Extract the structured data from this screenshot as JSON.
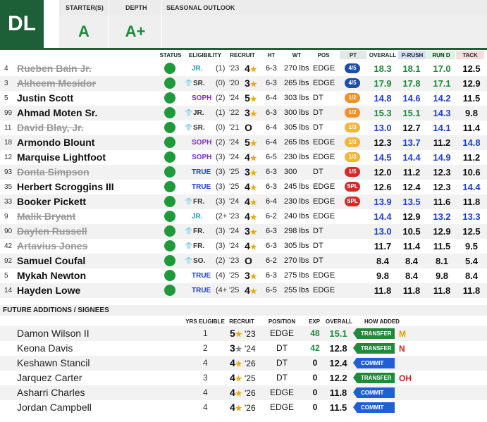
{
  "header": {
    "position": "DL",
    "starters_label": "STARTER(S)",
    "depth_label": "DEPTH",
    "outlook_label": "SEASONAL OUTLOOK",
    "starters_grade": "A",
    "depth_grade": "A+"
  },
  "columns": {
    "status": "STATUS",
    "eligibility": "ELIGIBILITY",
    "recruit": "RECRUIT",
    "ht": "HT",
    "wt": "WT",
    "pos": "POS",
    "pt": "PT",
    "overall": "OVERALL",
    "prush": "P-RUSH",
    "rund": "RUN D",
    "tack": "TACK"
  },
  "players": [
    {
      "num": "4",
      "name": "Rueben Bain Jr.",
      "out": true,
      "cls": "JR.",
      "cls_color": "#1a9bbd",
      "redshirt": false,
      "yr": "(1)",
      "rec": "'23",
      "star": "4",
      "ht": "6-3",
      "wt": "270 lbs",
      "pos": "EDGE",
      "pt": "4/5",
      "pt_color": "#1f4ea8",
      "ov": "18.3",
      "ov_c": "#1e8a3a",
      "pr": "18.1",
      "pr_c": "#1e8a3a",
      "rd": "17.0",
      "rd_c": "#1e8a3a",
      "tk": "12.5",
      "tk_c": "#111"
    },
    {
      "num": "3",
      "name": "Akheem Mesidor",
      "out": true,
      "cls": "SR.",
      "cls_color": "#333",
      "redshirt": true,
      "yr": "(0)",
      "rec": "'20",
      "star": "3",
      "ht": "6-3",
      "wt": "265 lbs",
      "pos": "EDGE",
      "pt": "4/5",
      "pt_color": "#1f4ea8",
      "ov": "17.9",
      "ov_c": "#1e8a3a",
      "pr": "17.8",
      "pr_c": "#1e8a3a",
      "rd": "17.1",
      "rd_c": "#1e8a3a",
      "tk": "12.9",
      "tk_c": "#111"
    },
    {
      "num": "5",
      "name": "Justin Scott",
      "out": false,
      "cls": "SOPH",
      "cls_color": "#7a2fbf",
      "redshirt": false,
      "yr": "(2)",
      "rec": "'24",
      "star": "5",
      "ht": "6-4",
      "wt": "303 lbs",
      "pos": "DT",
      "pt": "1/2",
      "pt_color": "#f0902a",
      "ov": "14.8",
      "ov_c": "#1f3fd6",
      "pr": "14.6",
      "pr_c": "#1f3fd6",
      "rd": "14.2",
      "rd_c": "#1f3fd6",
      "tk": "11.5",
      "tk_c": "#111"
    },
    {
      "num": "99",
      "name": "Ahmad Moten Sr.",
      "out": false,
      "cls": "JR.",
      "cls_color": "#333",
      "redshirt": true,
      "yr": "(1)",
      "rec": "'22",
      "star": "3",
      "ht": "6-3",
      "wt": "300 lbs",
      "pos": "DT",
      "pt": "1/2",
      "pt_color": "#f0902a",
      "ov": "15.3",
      "ov_c": "#1e8a3a",
      "pr": "15.1",
      "pr_c": "#1e8a3a",
      "rd": "14.3",
      "rd_c": "#1f3fd6",
      "tk": "9.8",
      "tk_c": "#111"
    },
    {
      "num": "11",
      "name": "David Blay, Jr.",
      "out": true,
      "cls": "SR.",
      "cls_color": "#333",
      "redshirt": true,
      "yr": "(0)",
      "rec": "'21",
      "star": "O",
      "ht": "6-4",
      "wt": "305 lbs",
      "pos": "DT",
      "pt": "1/3",
      "pt_color": "#f2b63a",
      "ov": "13.0",
      "ov_c": "#1f3fd6",
      "pr": "12.7",
      "pr_c": "#111",
      "rd": "14.1",
      "rd_c": "#1f3fd6",
      "tk": "11.4",
      "tk_c": "#111"
    },
    {
      "num": "18",
      "name": "Armondo Blount",
      "out": false,
      "cls": "SOPH",
      "cls_color": "#7a2fbf",
      "redshirt": false,
      "yr": "(2)",
      "rec": "'24",
      "star": "5",
      "ht": "6-4",
      "wt": "265 lbs",
      "pos": "EDGE",
      "pt": "1/3",
      "pt_color": "#f2b63a",
      "ov": "12.3",
      "ov_c": "#111",
      "pr": "13.7",
      "pr_c": "#1f3fd6",
      "rd": "11.2",
      "rd_c": "#111",
      "tk": "14.8",
      "tk_c": "#1f3fd6"
    },
    {
      "num": "12",
      "name": "Marquise Lightfoot",
      "out": false,
      "cls": "SOPH",
      "cls_color": "#7a2fbf",
      "redshirt": false,
      "yr": "(3)",
      "rec": "'24",
      "star": "4",
      "ht": "6-5",
      "wt": "230 lbs",
      "pos": "EDGE",
      "pt": "1/3",
      "pt_color": "#f2b63a",
      "ov": "14.5",
      "ov_c": "#1f3fd6",
      "pr": "14.4",
      "pr_c": "#1f3fd6",
      "rd": "14.9",
      "rd_c": "#1f3fd6",
      "tk": "11.2",
      "tk_c": "#111"
    },
    {
      "num": "93",
      "name": "Donta Simpson",
      "out": true,
      "cls": "TRUE",
      "cls_color": "#1f3fd6",
      "redshirt": false,
      "yr": "(3)",
      "rec": "'25",
      "star": "3",
      "ht": "6-3",
      "wt": "300",
      "pos": "DT",
      "pt": "1/5",
      "pt_color": "#d62a2a",
      "ov": "12.0",
      "ov_c": "#111",
      "pr": "11.2",
      "pr_c": "#111",
      "rd": "12.3",
      "rd_c": "#111",
      "tk": "10.6",
      "tk_c": "#111"
    },
    {
      "num": "35",
      "name": "Herbert Scroggins III",
      "out": false,
      "cls": "TRUE",
      "cls_color": "#1f3fd6",
      "redshirt": false,
      "yr": "(3)",
      "rec": "'25",
      "star": "4",
      "ht": "6-3",
      "wt": "245 lbs",
      "pos": "EDGE",
      "pt": "SPL",
      "pt_color": "#d62a2a",
      "ov": "12.6",
      "ov_c": "#111",
      "pr": "12.4",
      "pr_c": "#111",
      "rd": "12.3",
      "rd_c": "#111",
      "tk": "14.4",
      "tk_c": "#1f3fd6"
    },
    {
      "num": "33",
      "name": "Booker Pickett",
      "out": false,
      "cls": "FR.",
      "cls_color": "#333",
      "redshirt": true,
      "yr": "(3)",
      "rec": "'24",
      "star": "4",
      "ht": "6-4",
      "wt": "230 lbs",
      "pos": "EDGE",
      "pt": "SPL",
      "pt_color": "#d62a2a",
      "ov": "13.9",
      "ov_c": "#1f3fd6",
      "pr": "13.5",
      "pr_c": "#1f3fd6",
      "rd": "11.6",
      "rd_c": "#111",
      "tk": "11.8",
      "tk_c": "#111"
    },
    {
      "num": "9",
      "name": "Malik Bryant",
      "out": true,
      "cls": "JR.",
      "cls_color": "#1a9bbd",
      "redshirt": false,
      "yr": "(2+",
      "rec": "'23",
      "star": "4",
      "ht": "6-2",
      "wt": "240 lbs",
      "pos": "EDGE",
      "pt": "",
      "pt_color": "",
      "ov": "14.4",
      "ov_c": "#1f3fd6",
      "pr": "12.9",
      "pr_c": "#111",
      "rd": "13.2",
      "rd_c": "#1f3fd6",
      "tk": "13.3",
      "tk_c": "#1f3fd6"
    },
    {
      "num": "90",
      "name": "Daylen Russell",
      "out": true,
      "cls": "FR.",
      "cls_color": "#333",
      "redshirt": true,
      "yr": "(3)",
      "rec": "'24",
      "star": "3",
      "ht": "6-3",
      "wt": "298 lbs",
      "pos": "DT",
      "pt": "",
      "pt_color": "",
      "ov": "13.0",
      "ov_c": "#1f3fd6",
      "pr": "10.5",
      "pr_c": "#111",
      "rd": "12.9",
      "rd_c": "#111",
      "tk": "12.5",
      "tk_c": "#111"
    },
    {
      "num": "42",
      "name": "Artavius Jones",
      "out": true,
      "cls": "FR.",
      "cls_color": "#333",
      "redshirt": true,
      "yr": "(3)",
      "rec": "'24",
      "star": "4",
      "ht": "6-3",
      "wt": "305 lbs",
      "pos": "DT",
      "pt": "",
      "pt_color": "",
      "ov": "11.7",
      "ov_c": "#111",
      "pr": "11.4",
      "pr_c": "#111",
      "rd": "11.5",
      "rd_c": "#111",
      "tk": "9.5",
      "tk_c": "#111"
    },
    {
      "num": "92",
      "name": "Samuel Coufal",
      "out": false,
      "cls": "SO.",
      "cls_color": "#333",
      "redshirt": true,
      "yr": "(2)",
      "rec": "'23",
      "star": "O",
      "ht": "6-2",
      "wt": "270 lbs",
      "pos": "DT",
      "pt": "",
      "pt_color": "",
      "ov": "8.4",
      "ov_c": "#111",
      "pr": "8.4",
      "pr_c": "#111",
      "rd": "8.1",
      "rd_c": "#111",
      "tk": "5.4",
      "tk_c": "#111"
    },
    {
      "num": "5",
      "name": "Mykah Newton",
      "out": false,
      "cls": "TRUE",
      "cls_color": "#1f3fd6",
      "redshirt": false,
      "yr": "(4)",
      "rec": "'25",
      "star": "3",
      "ht": "6-3",
      "wt": "275 lbs",
      "pos": "EDGE",
      "pt": "",
      "pt_color": "",
      "ov": "9.8",
      "ov_c": "#111",
      "pr": "8.4",
      "pr_c": "#111",
      "rd": "9.8",
      "rd_c": "#111",
      "tk": "8.4",
      "tk_c": "#111"
    },
    {
      "num": "14",
      "name": "Hayden Lowe",
      "out": false,
      "cls": "TRUE",
      "cls_color": "#1f3fd6",
      "redshirt": false,
      "yr": "(4+",
      "rec": "'25",
      "star": "4",
      "ht": "6-5",
      "wt": "255 lbs",
      "pos": "EDGE",
      "pt": "",
      "pt_color": "",
      "ov": "11.8",
      "ov_c": "#111",
      "pr": "11.8",
      "pr_c": "#111",
      "rd": "11.8",
      "rd_c": "#111",
      "tk": "11.8",
      "tk_c": "#111"
    }
  ],
  "future": {
    "title": "FUTURE ADDITIONS / SIGNEES",
    "columns": {
      "yrs": "YRS ELIGIBLE",
      "recruit": "RECRUIT",
      "position": "POSITION",
      "exp": "EXP",
      "overall": "OVERALL",
      "how": "HOW ADDED"
    },
    "items": [
      {
        "name": "Damon Wilson II",
        "yrs": "1",
        "star": "5",
        "star_color": "#f0a800",
        "rec": "'23",
        "pos": "EDGE",
        "exp": "48",
        "exp_c": "#1e8a3a",
        "ov": "15.1",
        "ov_c": "#1e8a3a",
        "how": "TRANSFER",
        "how_type": "transfer",
        "logo": "M",
        "logo_color": "#d9a400"
      },
      {
        "name": "Keona Davis",
        "yrs": "2",
        "star": "3",
        "star_color": "#888",
        "rec": "'24",
        "pos": "DT",
        "exp": "42",
        "exp_c": "#1e8a3a",
        "ov": "12.8",
        "ov_c": "#111",
        "how": "TRANSFER",
        "how_type": "transfer",
        "logo": "N",
        "logo_color": "#d21f1f"
      },
      {
        "name": "Keshawn Stancil",
        "yrs": "4",
        "star": "4",
        "star_color": "#f0a800",
        "rec": "'26",
        "pos": "DT",
        "exp": "0",
        "exp_c": "#111",
        "ov": "12.4",
        "ov_c": "#111",
        "how": "COMMIT",
        "how_type": "commit",
        "logo": "",
        "logo_color": ""
      },
      {
        "name": "Jarquez Carter",
        "yrs": "3",
        "star": "4",
        "star_color": "#f0a800",
        "rec": "'25",
        "pos": "DT",
        "exp": "0",
        "exp_c": "#111",
        "ov": "12.2",
        "ov_c": "#111",
        "how": "TRANSFER",
        "how_type": "transfer",
        "logo": "OH",
        "logo_color": "#c41e1e"
      },
      {
        "name": "Asharri Charles",
        "yrs": "4",
        "star": "4",
        "star_color": "#f0a800",
        "rec": "'26",
        "pos": "EDGE",
        "exp": "0",
        "exp_c": "#111",
        "ov": "11.8",
        "ov_c": "#111",
        "how": "COMMIT",
        "how_type": "commit",
        "logo": "",
        "logo_color": ""
      },
      {
        "name": "Jordan Campbell",
        "yrs": "4",
        "star": "4",
        "star_color": "#f0a800",
        "rec": "'26",
        "pos": "EDGE",
        "exp": "0",
        "exp_c": "#111",
        "ov": "11.5",
        "ov_c": "#111",
        "how": "COMMIT",
        "how_type": "commit",
        "logo": "",
        "logo_color": ""
      }
    ]
  }
}
